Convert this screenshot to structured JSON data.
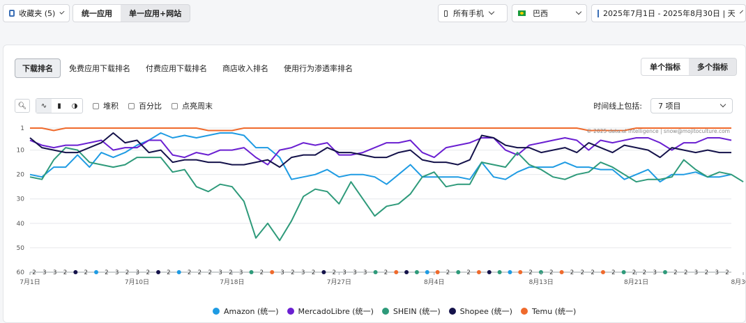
{
  "topbar": {
    "favorites_label": "收藏夹 (5)",
    "unified_app_label": "统一应用",
    "single_app_label": "单一应用+网站",
    "device_label": "所有手机",
    "country_label": "巴西",
    "date_range_label": "2025年7月1日 - 2025年8月30日 | 天"
  },
  "tabs": [
    "下载排名",
    "免费应用下载排名",
    "付费应用下载排名",
    "商店收入排名",
    "使用行为渗透率排名"
  ],
  "metric_toggle": {
    "single": "单个指标",
    "multiple": "多个指标"
  },
  "options": {
    "stacked": "堆积",
    "percent": "百分比",
    "highlight_weekend": "点亮周末",
    "timeline_label": "时间线上包括:",
    "timeline_value": "7 项目"
  },
  "watermark": "© 2025 data.ai Intelligence | snow@mojitoculture.com",
  "chart_data": {
    "type": "line",
    "y_reversed": true,
    "ylim": [
      1,
      60
    ],
    "y_ticks": [
      1,
      10,
      20,
      30,
      40,
      50,
      60
    ],
    "x_tick_labels": [
      "7月1日",
      "7月10日",
      "7月18日",
      "7月27日",
      "8月4日",
      "8月13日",
      "8月21日",
      "8月30日"
    ],
    "x_tick_index": [
      0,
      9,
      17,
      26,
      34,
      43,
      51,
      60
    ],
    "annotation_counts": [
      "2",
      "3",
      "3",
      "2",
      "",
      "2",
      "",
      "2",
      "3",
      "2",
      "3",
      "2",
      "",
      "2",
      "",
      "2",
      "2",
      "2",
      "3",
      "2",
      "3",
      "",
      "2",
      "",
      "3",
      "2",
      "3",
      "2",
      "",
      "2",
      "3",
      "3",
      "3",
      "",
      "2",
      "",
      "",
      "",
      "",
      "",
      "2",
      "",
      "2",
      "",
      "",
      "",
      "",
      "",
      "2",
      "",
      "2",
      "",
      "2",
      "2",
      "2",
      "",
      "2",
      "",
      "2",
      "2",
      "3",
      "",
      "2",
      "2",
      "3",
      "2",
      "3",
      "2"
    ],
    "series": [
      {
        "name": "Amazon (统一)",
        "color": "#1e9be3",
        "values": [
          20,
          21,
          17,
          17,
          12,
          17,
          11,
          13,
          11,
          8,
          6,
          3,
          5,
          4,
          5,
          4,
          3,
          3,
          4,
          9,
          9,
          13,
          22,
          21,
          20,
          18,
          21,
          20,
          20,
          21,
          24,
          20,
          16,
          21,
          21,
          21,
          21,
          22,
          15,
          21,
          22,
          19,
          17,
          17,
          17,
          15,
          17,
          17,
          18,
          18,
          22,
          20,
          18,
          23,
          20,
          20,
          19,
          21,
          21,
          20
        ]
      },
      {
        "name": "MercadoLibre (统一)",
        "color": "#6a1fd1",
        "values": [
          6,
          8,
          9,
          8,
          8,
          7,
          6,
          10,
          9,
          9,
          6,
          6,
          12,
          13,
          11,
          12,
          10,
          10,
          9,
          13,
          16,
          10,
          9,
          7,
          8,
          7,
          12,
          12,
          11,
          9,
          7,
          7,
          6,
          11,
          13,
          9,
          8,
          7,
          5,
          5,
          10,
          12,
          8,
          7,
          6,
          5,
          6,
          10,
          6,
          7,
          6,
          5,
          5,
          7,
          10,
          7,
          7,
          5,
          5,
          6
        ]
      },
      {
        "name": "SHEIN (统一)",
        "color": "#2e9a7a",
        "values": [
          21,
          22,
          14,
          9,
          10,
          15,
          16,
          17,
          16,
          13,
          13,
          13,
          19,
          18,
          25,
          27,
          24,
          25,
          31,
          46,
          40,
          47,
          39,
          29,
          26,
          27,
          32,
          23,
          30,
          37,
          33,
          32,
          28,
          21,
          19,
          25,
          24,
          24,
          15,
          16,
          17,
          11,
          16,
          18,
          21,
          22,
          20,
          19,
          15,
          17,
          20,
          23,
          22,
          22,
          21,
          14,
          18,
          21,
          19,
          20,
          23
        ]
      },
      {
        "name": "Shopee (统一)",
        "color": "#14124a",
        "values": [
          5,
          9,
          10,
          11,
          11,
          9,
          7,
          3,
          7,
          6,
          11,
          10,
          15,
          14,
          14,
          15,
          15,
          16,
          16,
          15,
          14,
          17,
          13,
          12,
          12,
          9,
          11,
          11,
          12,
          13,
          13,
          11,
          10,
          14,
          15,
          15,
          16,
          14,
          4,
          5,
          8,
          9,
          9,
          11,
          10,
          9,
          11,
          7,
          9,
          11,
          8,
          9,
          10,
          13,
          9,
          10,
          11,
          10,
          11,
          11
        ]
      },
      {
        "name": "Temu (统一)",
        "color": "#ef6a2c",
        "values": [
          1,
          1,
          2,
          1,
          1,
          1,
          1,
          1,
          1,
          1,
          1,
          1,
          1,
          1,
          1,
          2,
          2,
          2,
          1,
          1,
          1,
          1,
          1,
          1,
          1,
          1,
          1,
          1,
          1,
          1,
          1,
          1,
          1,
          1,
          1,
          1,
          1,
          1,
          1,
          1,
          1,
          1,
          1,
          1,
          1,
          1,
          1,
          2,
          2,
          2,
          2,
          1,
          1,
          1,
          1,
          1,
          1,
          1,
          1,
          1
        ]
      }
    ]
  }
}
